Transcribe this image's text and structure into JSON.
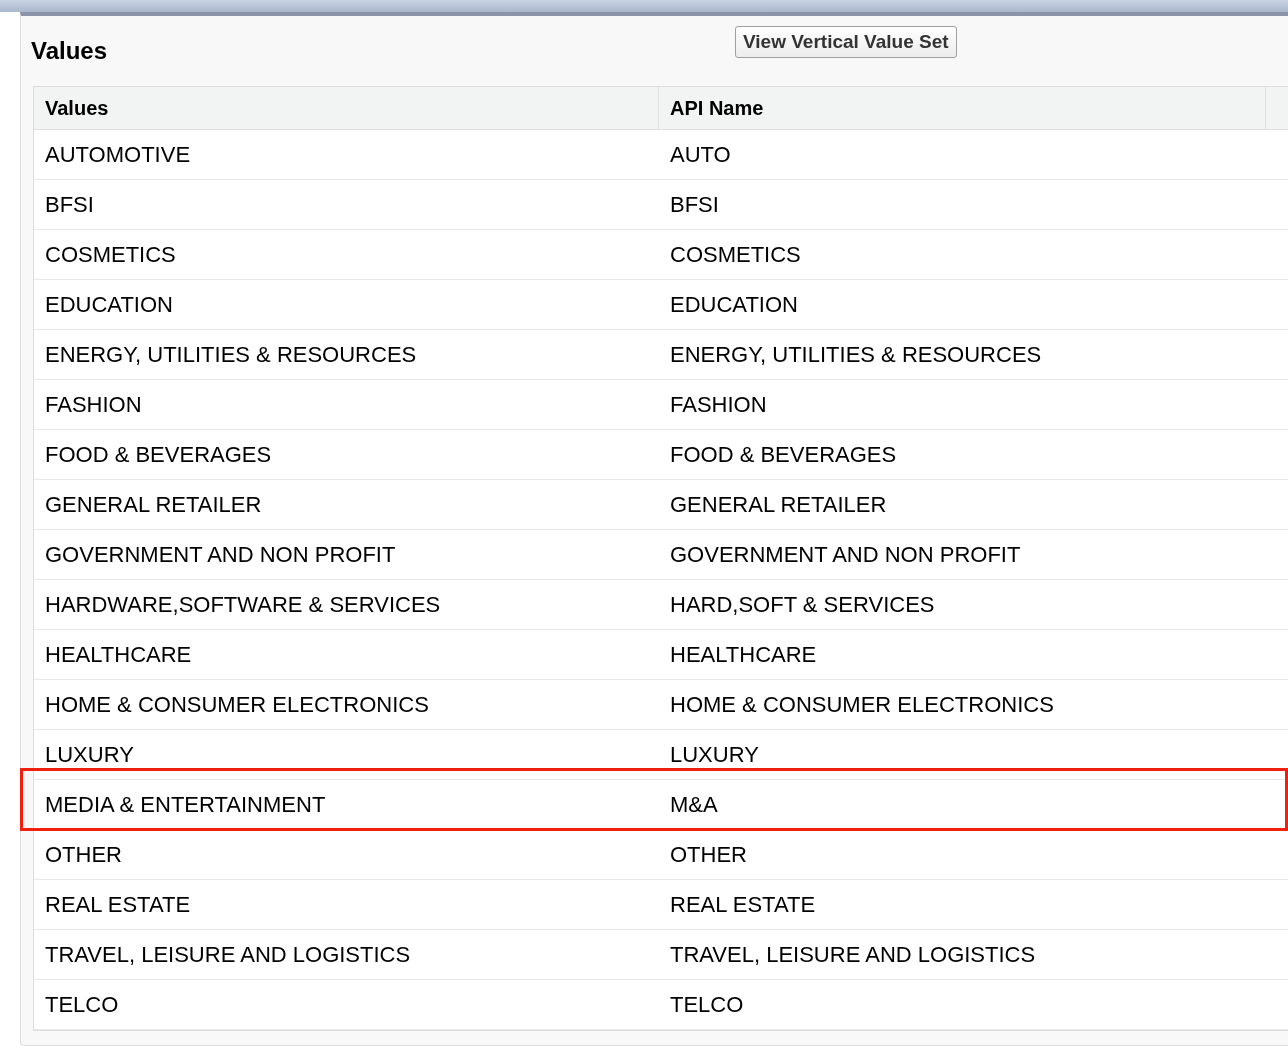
{
  "panel": {
    "title": "Values",
    "button": "View Vertical Value Set"
  },
  "table": {
    "columns": [
      "Values",
      "API Name"
    ],
    "rows": [
      {
        "value": "AUTOMOTIVE",
        "api_name": "AUTO",
        "highlighted": false
      },
      {
        "value": "BFSI",
        "api_name": "BFSI",
        "highlighted": false
      },
      {
        "value": "COSMETICS",
        "api_name": "COSMETICS",
        "highlighted": false
      },
      {
        "value": "EDUCATION",
        "api_name": "EDUCATION",
        "highlighted": false
      },
      {
        "value": "ENERGY, UTILITIES & RESOURCES",
        "api_name": "ENERGY, UTILITIES & RESOURCES",
        "highlighted": false
      },
      {
        "value": "FASHION",
        "api_name": "FASHION",
        "highlighted": false
      },
      {
        "value": "FOOD & BEVERAGES",
        "api_name": "FOOD & BEVERAGES",
        "highlighted": false
      },
      {
        "value": "GENERAL RETAILER",
        "api_name": "GENERAL RETAILER",
        "highlighted": false
      },
      {
        "value": "GOVERNMENT AND NON PROFIT",
        "api_name": "GOVERNMENT AND NON PROFIT",
        "highlighted": false
      },
      {
        "value": "HARDWARE,SOFTWARE & SERVICES",
        "api_name": "HARD,SOFT & SERVICES",
        "highlighted": false
      },
      {
        "value": "HEALTHCARE",
        "api_name": "HEALTHCARE",
        "highlighted": false
      },
      {
        "value": "HOME & CONSUMER ELECTRONICS",
        "api_name": "HOME & CONSUMER ELECTRONICS",
        "highlighted": false
      },
      {
        "value": "LUXURY",
        "api_name": "LUXURY",
        "highlighted": false
      },
      {
        "value": "MEDIA & ENTERTAINMENT",
        "api_name": "M&A",
        "highlighted": true
      },
      {
        "value": "OTHER",
        "api_name": "OTHER",
        "highlighted": false
      },
      {
        "value": "REAL ESTATE",
        "api_name": "REAL ESTATE",
        "highlighted": false
      },
      {
        "value": "TRAVEL, LEISURE AND LOGISTICS",
        "api_name": "TRAVEL, LEISURE AND LOGISTICS",
        "highlighted": false
      },
      {
        "value": "TELCO",
        "api_name": "TELCO",
        "highlighted": false
      }
    ]
  }
}
